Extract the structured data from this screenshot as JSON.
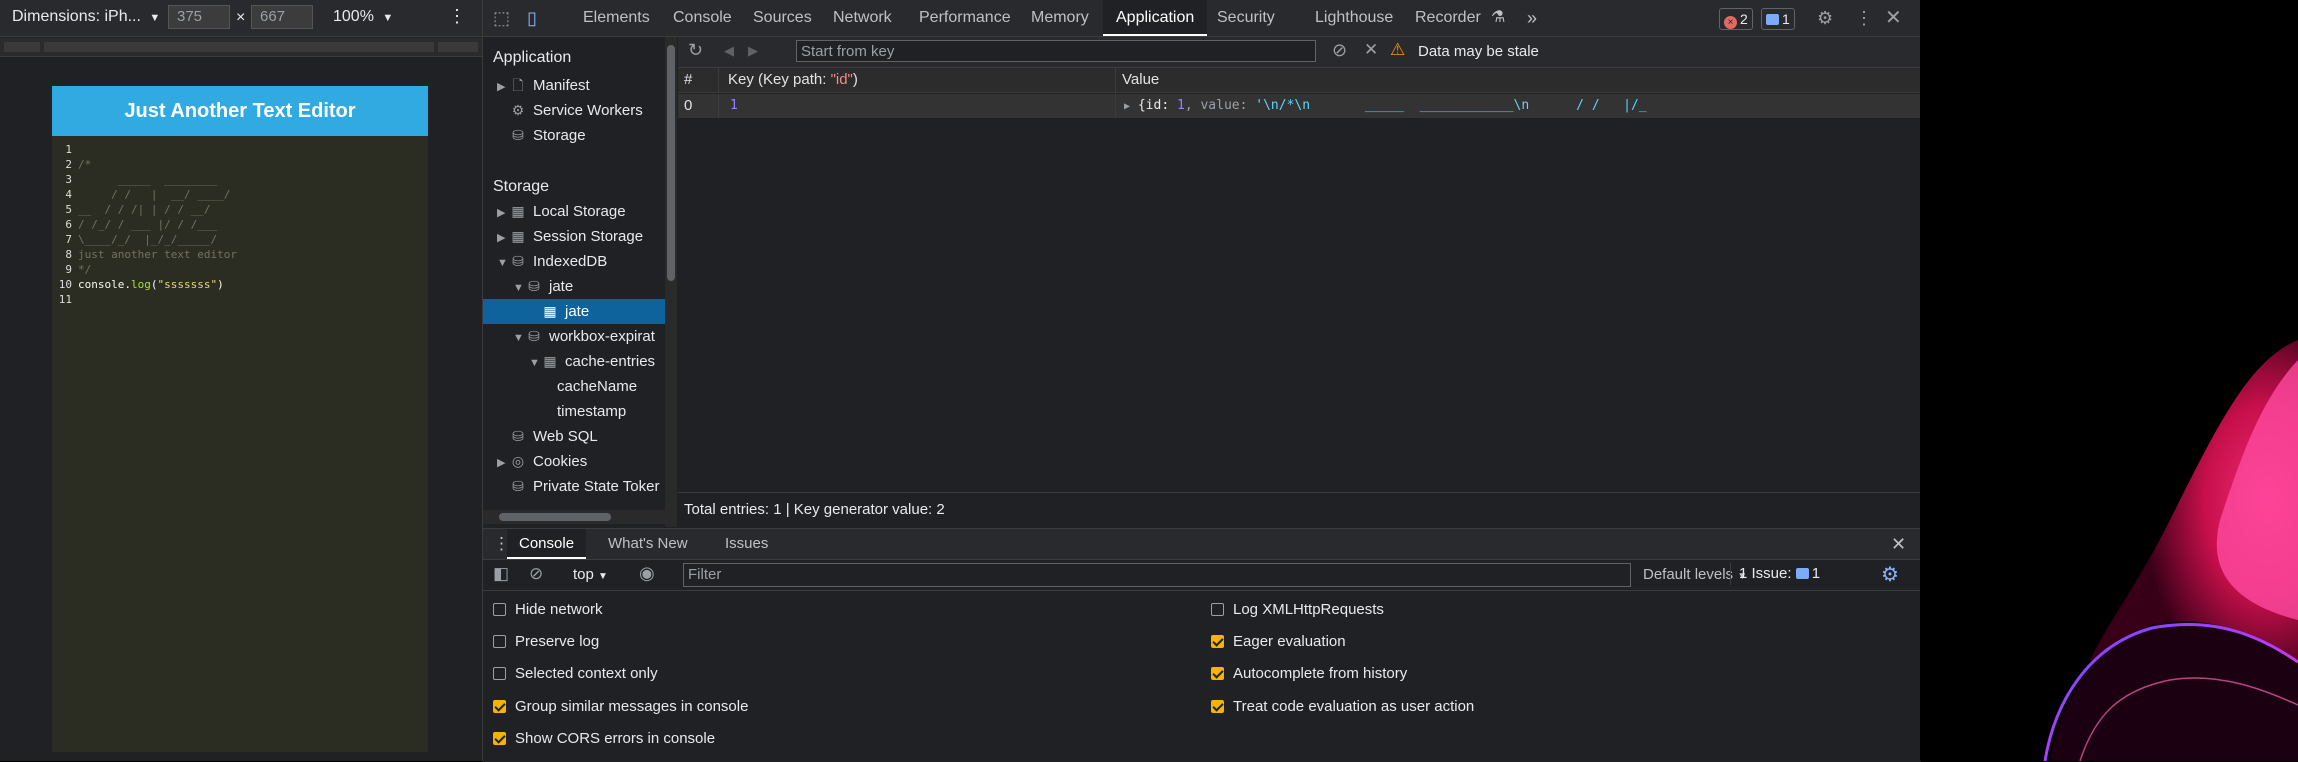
{
  "device_toolbar": {
    "dimensions_label": "Dimensions: iPh...",
    "width_value": "375",
    "times": "×",
    "height_value": "667",
    "zoom": "100%"
  },
  "editor": {
    "title": "Just Another Text Editor",
    "lines": [
      {
        "n": "1",
        "text": ""
      },
      {
        "n": "2",
        "text": "/*"
      },
      {
        "n": "3",
        "text": "      _____  ________"
      },
      {
        "n": "4",
        "text": "     / /   |  __/ ____/"
      },
      {
        "n": "5",
        "text": "__  / / /| | / / __/"
      },
      {
        "n": "6",
        "text": "/ /_/ / ___ |/ / /___"
      },
      {
        "n": "7",
        "text": "\\____/_/  |_/_/_____/"
      },
      {
        "n": "8",
        "text": "just another text editor"
      },
      {
        "n": "9",
        "text": "*/"
      },
      {
        "n": "10",
        "text": ""
      },
      {
        "n": "11",
        "text": ""
      }
    ],
    "code_line": {
      "obj": "console",
      "dot": ".",
      "fn": "log",
      "open": "(",
      "str": "\"sssssss\"",
      "close": ")"
    }
  },
  "devtools": {
    "tabs": [
      "Elements",
      "Console",
      "Sources",
      "Network",
      "Performance",
      "Memory",
      "Application",
      "Security",
      "Lighthouse",
      "Recorder"
    ],
    "active_tab": "Application",
    "more_tabs": "»",
    "errors_count": "2",
    "messages_count": "1",
    "error_badge_glyph": "×",
    "sidebar": {
      "application_header": "Application",
      "manifest": "Manifest",
      "service_workers": "Service Workers",
      "storage_item": "Storage",
      "storage_header": "Storage",
      "local_storage": "Local Storage",
      "session_storage": "Session Storage",
      "indexeddb": "IndexedDB",
      "db_jate": "jate",
      "store_jate": "jate",
      "workbox": "workbox-expirat",
      "cache_entries": "cache-entries",
      "cache_name": "cacheName",
      "timestamp": "timestamp",
      "web_sql": "Web SQL",
      "cookies": "Cookies",
      "private_state": "Private State Toker"
    },
    "idb": {
      "start_from_key_placeholder": "Start from key",
      "stale_warning": "Data may be stale",
      "col_index": "#",
      "col_key": "Key (Key path: \"id\")",
      "col_key_prefix": "Key (Key path: ",
      "col_key_path": "\"id\"",
      "col_key_suffix": ")",
      "col_value": "Value",
      "row": {
        "index": "0",
        "key": "1",
        "value_prefix": "{id: ",
        "value_id": "1",
        "value_mid": ", value: ",
        "value_str": "'\\n/*\\n       _____  ____________\\n      / /   |/_"
      },
      "footer": "Total entries: 1  |  Key generator value: 2"
    },
    "drawer": {
      "tabs": [
        "Console",
        "What's New",
        "Issues"
      ],
      "active_tab": "Console",
      "context": "top",
      "filter_placeholder": "Filter",
      "levels": "Default levels",
      "issues_label": "1 Issue:",
      "issues_count": "1",
      "settings_left": [
        {
          "label": "Hide network",
          "checked": false
        },
        {
          "label": "Preserve log",
          "checked": false
        },
        {
          "label": "Selected context only",
          "checked": false
        },
        {
          "label": "Group similar messages in console",
          "checked": true
        },
        {
          "label": "Show CORS errors in console",
          "checked": true
        }
      ],
      "settings_right": [
        {
          "label": "Log XMLHttpRequests",
          "checked": false
        },
        {
          "label": "Eager evaluation",
          "checked": true
        },
        {
          "label": "Autocomplete from history",
          "checked": true
        },
        {
          "label": "Treat code evaluation as user action",
          "checked": true
        }
      ]
    }
  },
  "colors": {
    "editor_header": "#31a9e1",
    "selection": "#0e639c",
    "checkbox_on": "#f4b400",
    "error_red": "#e46962",
    "info_blue": "#7cacf8"
  }
}
